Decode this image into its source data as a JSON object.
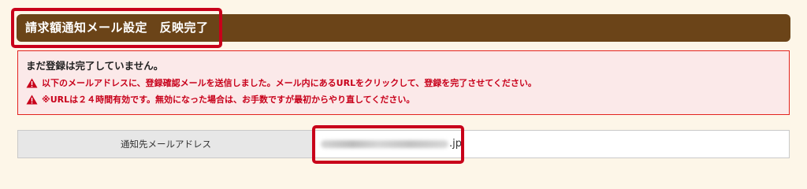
{
  "header": {
    "title": "請求額通知メール設定　反映完了"
  },
  "alert": {
    "heading": "まだ登録は完了していません。",
    "messages": [
      "以下のメールアドレスに、登録確認メールを送信しました。メール内にあるURLをクリックして、登録を完了させてください。",
      "※URLは２４時間有効です。無効になった場合は、お手数ですが最初からやり直してください。"
    ],
    "icon": "warning-triangle-icon",
    "color": "#c8001a",
    "background": "#fbe9e9"
  },
  "form": {
    "label": "通知先メールアドレス",
    "email_suffix": ".jp"
  },
  "colors": {
    "header_bg": "#6b4418",
    "highlight": "#c8001a",
    "page_bg": "#fdf6e8"
  }
}
